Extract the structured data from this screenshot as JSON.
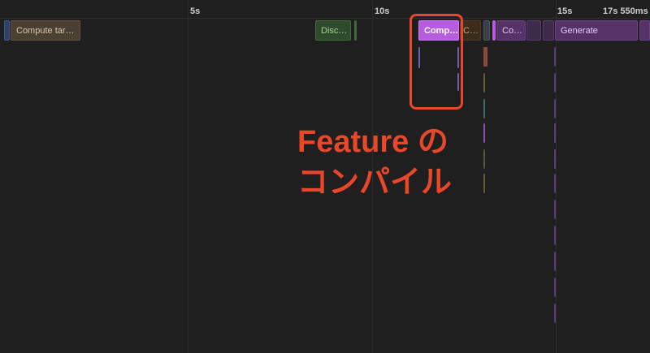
{
  "ruler": {
    "ticks": [
      "5s",
      "10s",
      "15s"
    ],
    "end_label": "17s 550ms"
  },
  "tasks": {
    "compute_targets": "Compute tar…",
    "discover": "Disc…",
    "compile_selected": "Comp…",
    "c_small": "C…",
    "co": "Co…",
    "generate": "Generate"
  },
  "annotation": {
    "line1": "Feature の",
    "line2": "コンパイル",
    "color": "#e8472a"
  },
  "colors": {
    "background": "#1f1f1f",
    "compute_brown": "#4a4034",
    "discover_green": "#2f4a2c",
    "compile_purple": "#b75ce0",
    "generate_purple": "#553268",
    "annotation_red": "#e8472a"
  }
}
